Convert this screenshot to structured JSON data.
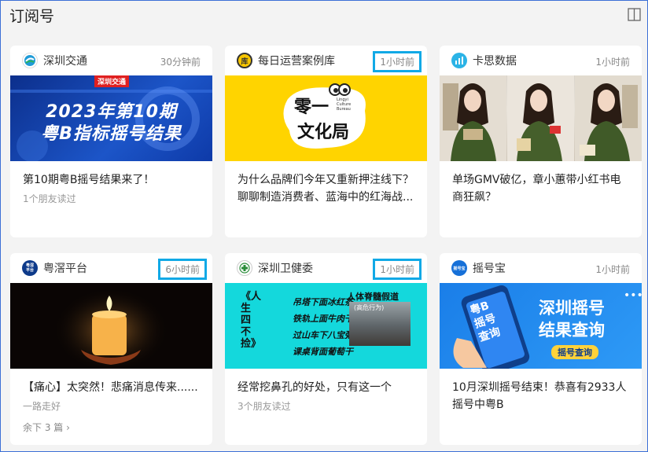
{
  "header": {
    "title": "订阅号"
  },
  "cards": [
    {
      "source": "深圳交通",
      "time": "30分钟前",
      "thumb_banner": "深圳交通",
      "thumb_line1": "2023年第10期",
      "thumb_line2": "粤B指标摇号结果",
      "title": "第10期粤B摇号结果来了！",
      "meta": "1个朋友读过"
    },
    {
      "source": "每日运营案例库",
      "time": "1小时前",
      "avatar_text": "库",
      "thumb_line1": "零一",
      "thumb_line2": "文化局",
      "thumb_small": "Lingyi Culture Bureau",
      "title": "为什么品牌们今年又重新押注线下？聊聊制造消费者、蓝海中的红海战...",
      "meta": ""
    },
    {
      "source": "卡思数据",
      "time": "1小时前",
      "title": "单场GMV破亿，章小蕙带小红书电商狂飙？",
      "meta": ""
    },
    {
      "source": "粤滘平台",
      "time": "6小时前",
      "avatar_text": "粤滘平台",
      "title": "【痛心】太突然！悲痛消息传来......",
      "meta": "一路走好",
      "more": "余下 3 篇 ›"
    },
    {
      "source": "深圳卫健委",
      "time": "1小时前",
      "thumb_vertical": "《人生四不捡》",
      "thumb_lines": [
        "吊塔下面冰红茶",
        "铁轨上面牛肉干",
        "过山车下八宝粥",
        "课桌背面葡萄干"
      ],
      "thumb_side_title": "人体脊髓假道",
      "thumb_side_sub": "(高危行为)",
      "title": "经常挖鼻孔的好处，只有这一个",
      "meta": "3个朋友读过"
    },
    {
      "source": "摇号宝",
      "time": "1小时前",
      "avatar_text": "摇号宝",
      "thumb_phone": "粤B摇号查询",
      "thumb_line1": "深圳摇号",
      "thumb_line2": "结果查询",
      "thumb_btn": "摇号查询",
      "title": "10月深圳摇号结束！恭喜有2933人摇号中粤B",
      "meta": ""
    }
  ]
}
